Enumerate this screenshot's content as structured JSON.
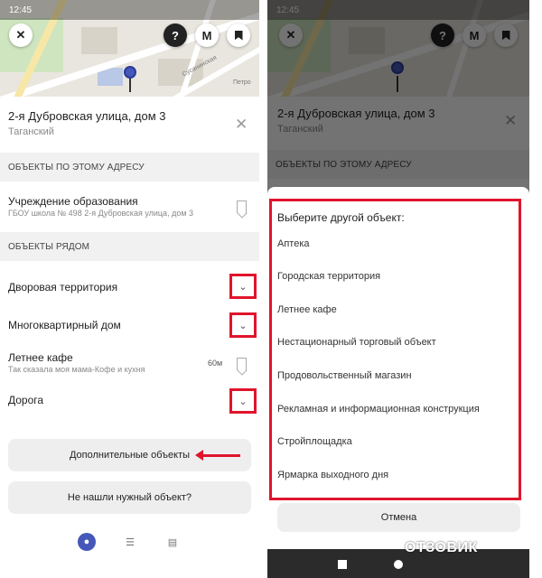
{
  "status_time": "12:45",
  "map_street": "Сусанинская",
  "map_poi": "Петро",
  "header": {
    "title": "2-я Дубровская улица, дом 3",
    "district": "Таганский"
  },
  "sections": {
    "at_address": "ОБЪЕКТЫ ПО ЭТОМУ АДРЕСУ",
    "nearby": "ОБЪЕКТЫ РЯДОМ"
  },
  "address_objects": [
    {
      "title": "Учреждение образования",
      "subtitle": "ГБОУ школа № 498 2-я Дубровская улица, дом 3"
    }
  ],
  "nearby_objects": [
    {
      "title": "Дворовая территория"
    },
    {
      "title": "Многоквартирный дом"
    },
    {
      "title": "Летнее кафе",
      "subtitle": "Так сказала моя мама-Кофе и кухня",
      "distance": "60м"
    },
    {
      "title": "Дорога"
    }
  ],
  "buttons": {
    "more_objects": "Дополнительные объекты",
    "not_found": "Не нашли нужный объект?"
  },
  "picker": {
    "title": "Выберите другой объект:",
    "options": [
      "Аптека",
      "Городская территория",
      "Летнее кафе",
      "Нестационарный торговый объект",
      "Продовольственный магазин",
      "Рекламная и информационная конструкция",
      "Стройплощадка",
      "Ярмарка выходного дня"
    ],
    "cancel": "Отмена"
  },
  "watermark": "ОТЗОВИК",
  "colors": {
    "highlight": "#e0142c",
    "accent": "#4557b8"
  }
}
